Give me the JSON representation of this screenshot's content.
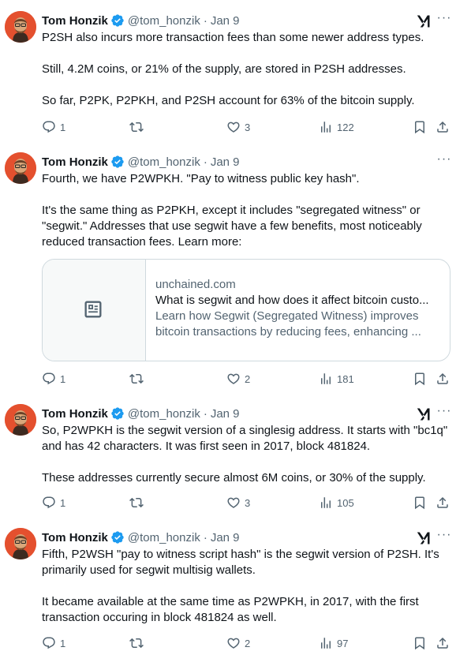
{
  "author": {
    "name": "Tom Honzik",
    "handle": "@tom_honzik",
    "date": "Jan 9"
  },
  "colors": {
    "accent": "#1d9bf0",
    "muted": "#536471",
    "border": "#cfd9de"
  },
  "tweets": [
    {
      "paragraphs": [
        "P2SH also incurs more transaction fees than some newer address types.",
        "Still, 4.2M coins, or 21% of the supply, are stored in P2SH addresses.",
        "So far, P2PK, P2PKH, and P2SH account for 63% of the bitcoin supply."
      ],
      "replies": "1",
      "reposts": "",
      "likes": "3",
      "views": "122"
    },
    {
      "paragraphs": [
        "Fourth, we have P2WPKH. \"Pay to witness public key hash\".",
        "It's the same thing as P2PKH, except it includes \"segregated witness\" or \"segwit.\" Addresses that use segwit have a few benefits, most noticeably reduced transaction fees. Learn more:"
      ],
      "card": {
        "domain": "unchained.com",
        "title": "What is segwit and how does it affect bitcoin custo...",
        "description": "Learn how Segwit (Segregated Witness) improves bitcoin transactions by reducing fees, enhancing ..."
      },
      "replies": "1",
      "reposts": "",
      "likes": "2",
      "views": "181"
    },
    {
      "paragraphs": [
        "So, P2WPKH is the segwit version of a singlesig address.  It starts with \"bc1q\" and has 42 characters. It was first seen in 2017, block 481824.",
        "These addresses currently secure almost 6M coins, or 30% of the supply."
      ],
      "replies": "1",
      "reposts": "",
      "likes": "3",
      "views": "105"
    },
    {
      "paragraphs": [
        "Fifth, P2WSH \"pay to witness script hash\" is the segwit version of P2SH. It's primarily used for segwit multisig wallets.",
        "It became available at the same time as P2WPKH, in 2017, with the first transaction occuring in block 481824 as well."
      ],
      "replies": "1",
      "reposts": "",
      "likes": "2",
      "views": "97"
    }
  ]
}
